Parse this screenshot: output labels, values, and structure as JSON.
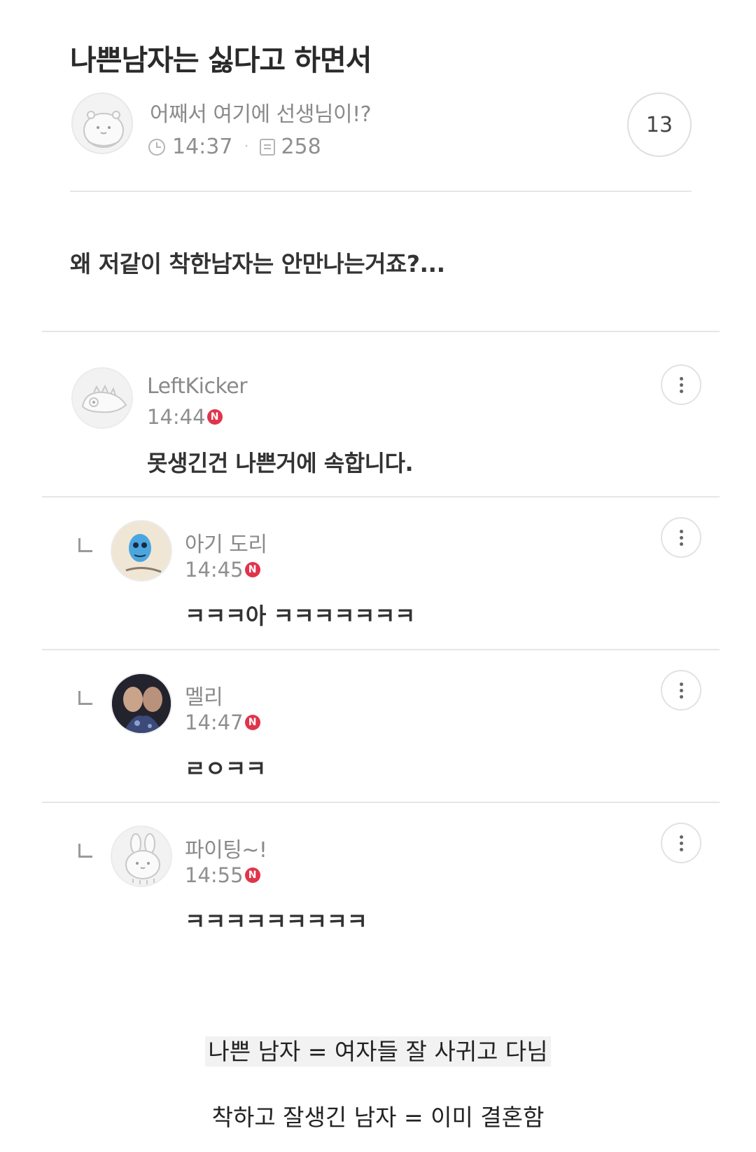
{
  "post": {
    "title": "나쁜남자는 싫다고 하면서",
    "author": "어째서 여기에 선생님이!?",
    "time": "14:37",
    "views": "258",
    "comment_count": "13",
    "body": "왜 저같이 착한남자는 안만나는거죠?..."
  },
  "comments": [
    {
      "name": "LeftKicker",
      "time": "14:44",
      "badge": "N",
      "text": "못생긴건 나쁜거에 속합니다."
    },
    {
      "name": "아기 도리",
      "time": "14:45",
      "badge": "N",
      "text": "ㅋㅋㅋ아 ㅋㅋㅋㅋㅋㅋㅋ"
    },
    {
      "name": "멜리",
      "time": "14:47",
      "badge": "N",
      "text": "ㄹㅇㅋㅋ"
    },
    {
      "name": "파이팅~!",
      "time": "14:55",
      "badge": "N",
      "text": "ㅋㅋㅋㅋㅋㅋㅋㅋㅋ"
    }
  ],
  "captions": {
    "line1": "나쁜 남자 = 여자들 잘 사귀고 다님",
    "line2": "착하고 잘생긴 남자 = 이미 결혼함"
  },
  "colors": {
    "badge": "#e0344a",
    "divider": "#e6e6e6"
  }
}
